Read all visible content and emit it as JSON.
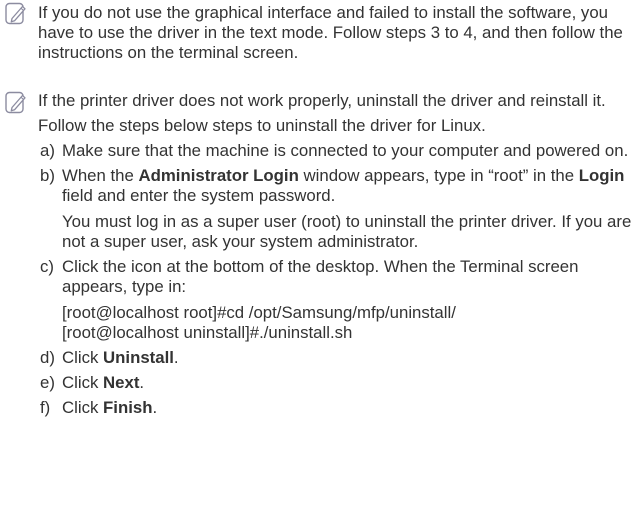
{
  "colors": {
    "text": "#333333",
    "icon_stroke": "#8c8ca0"
  },
  "icons": [
    "note-icon",
    "note-icon"
  ],
  "note1": {
    "text": "If you do not use the graphical interface and failed to install the software, you have to use the driver in the text mode. Follow steps 3 to 4, and then follow the instructions on the terminal screen."
  },
  "note2": {
    "text": "If the printer driver does not work properly, uninstall the driver and reinstall it.",
    "intro": "Follow the steps below steps to uninstall the driver for Linux.",
    "steps": {
      "a": {
        "marker": "a)",
        "text": "Make sure that the machine is connected to your computer and powered on."
      },
      "b": {
        "marker": "b)",
        "t1": "When the ",
        "b1": "Administrator Login",
        "t2": " window appears, type in “root” in the ",
        "b2": "Login",
        "t3": " field and enter the system password.",
        "sub": "You must log in as a super user (root) to uninstall the printer driver. If you are not a super user, ask your system administrator."
      },
      "c": {
        "marker": "c)",
        "text": "Click the icon at the bottom of the desktop. When the Terminal screen appears, type in:",
        "code1": "[root@localhost root]#cd /opt/Samsung/mfp/uninstall/",
        "code2": "[root@localhost uninstall]#./uninstall.sh"
      },
      "d": {
        "marker": "d)",
        "t1": "Click ",
        "b1": "Uninstall",
        "t2": "."
      },
      "e": {
        "marker": "e)",
        "t1": "Click ",
        "b1": "Next",
        "t2": "."
      },
      "f": {
        "marker": "f)",
        "t1": "Click ",
        "b1": "Finish",
        "t2": "."
      }
    }
  }
}
